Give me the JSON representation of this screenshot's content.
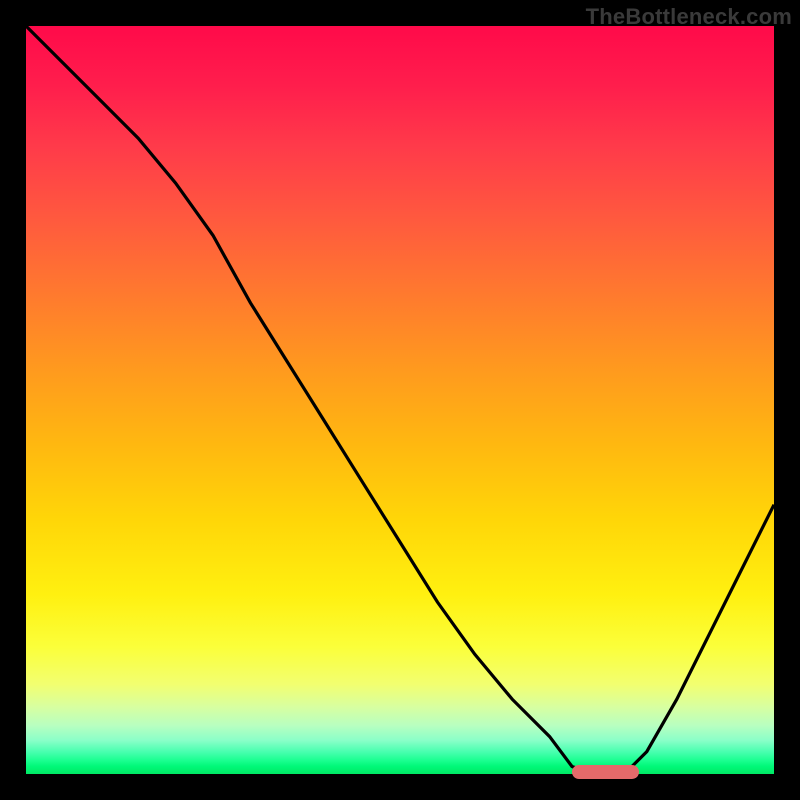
{
  "watermark": "TheBottleneck.com",
  "colors": {
    "frame": "#000000",
    "curve": "#000000",
    "marker": "#e46a6a",
    "gradient_top": "#ff0a4a",
    "gradient_bottom": "#00e864"
  },
  "chart_data": {
    "type": "line",
    "title": "",
    "xlabel": "",
    "ylabel": "",
    "xlim": [
      0,
      100
    ],
    "ylim": [
      0,
      100
    ],
    "grid": false,
    "legend": false,
    "note": "No axis ticks or numeric labels are rendered; values are read as percentages of the plot area (0 = left/bottom, 100 = right/top).",
    "series": [
      {
        "name": "bottleneck-curve",
        "x": [
          0,
          5,
          10,
          15,
          20,
          25,
          30,
          35,
          40,
          45,
          50,
          55,
          60,
          65,
          70,
          73,
          76,
          80,
          83,
          87,
          91,
          95,
          100
        ],
        "y": [
          100,
          95,
          90,
          85,
          79,
          72,
          63,
          55,
          47,
          39,
          31,
          23,
          16,
          10,
          5,
          1,
          0,
          0,
          3,
          10,
          18,
          26,
          36
        ]
      }
    ],
    "marker": {
      "name": "highlight-bar",
      "x_start": 73,
      "x_end": 82,
      "y": 0,
      "color": "#e46a6a"
    }
  }
}
